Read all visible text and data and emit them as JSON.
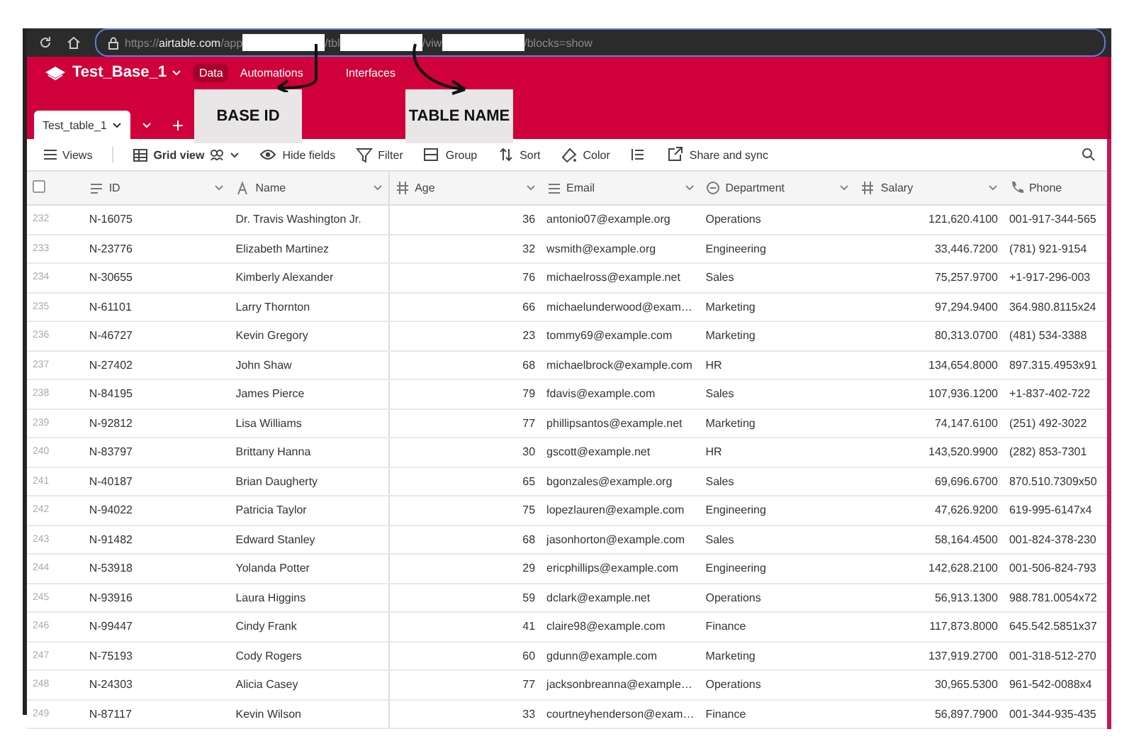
{
  "browser": {
    "url_segments": [
      {
        "text": "https://",
        "kind": "dim"
      },
      {
        "text": "airtable.com",
        "kind": "host"
      },
      {
        "text": "/app",
        "kind": "dim"
      },
      {
        "text": "/tbl",
        "kind": "dim"
      },
      {
        "text": "/viw",
        "kind": "dim"
      },
      {
        "text": "/blocks=show",
        "kind": "dim"
      }
    ]
  },
  "app": {
    "base_name": "Test_Base_1",
    "nav": [
      {
        "label": "Data",
        "selected": true
      },
      {
        "label": "Automations",
        "selected": false
      },
      {
        "label": "Interfaces",
        "selected": false
      }
    ]
  },
  "table_tabs": [
    {
      "label": "Test_table_1",
      "selected": true
    }
  ],
  "annotations": [
    {
      "label": "BASE ID"
    },
    {
      "label": "TABLE NAME"
    }
  ],
  "toolbar": {
    "views": "Views",
    "view_name": "Grid view",
    "items": [
      {
        "label": "Hide fields",
        "kind": "eye"
      },
      {
        "label": "Filter",
        "kind": "filter"
      },
      {
        "label": "Group",
        "kind": "group"
      },
      {
        "label": "Sort",
        "kind": "sort"
      },
      {
        "label": "Color",
        "kind": "color"
      },
      {
        "kind": "height"
      },
      {
        "label": "Share and sync",
        "kind": "share"
      }
    ]
  },
  "table": {
    "columns": [
      {
        "kind": "checkbox",
        "checked": false
      },
      {
        "label": "ID",
        "kind": "text"
      },
      {
        "label": "Name",
        "kind": "user"
      },
      {
        "label": "Age",
        "kind": "number"
      },
      {
        "label": "Email",
        "kind": "email"
      },
      {
        "label": "Department",
        "kind": "select"
      },
      {
        "label": "Salary",
        "kind": "number"
      },
      {
        "label": "Phone",
        "kind": "phone"
      }
    ],
    "rows": [
      [
        "232",
        "N-16075",
        "Dr. Travis Washington Jr.",
        "36",
        "antonio07@example.org",
        "Operations",
        "121,620.4100",
        "001-917-344-565"
      ],
      [
        "233",
        "N-23776",
        "Elizabeth Martinez",
        "32",
        "wsmith@example.org",
        "Engineering",
        "33,446.7200",
        "(781) 921-9154"
      ],
      [
        "234",
        "N-30655",
        "Kimberly Alexander",
        "76",
        "michaelross@example.net",
        "Sales",
        "75,257.9700",
        "+1-917-296-003"
      ],
      [
        "235",
        "N-61101",
        "Larry Thornton",
        "66",
        "michaelunderwood@exam…",
        "Marketing",
        "97,294.9400",
        "364.980.8115x24"
      ],
      [
        "236",
        "N-46727",
        "Kevin Gregory",
        "23",
        "tommy69@example.com",
        "Marketing",
        "80,313.0700",
        "(481) 534-3388"
      ],
      [
        "237",
        "N-27402",
        "John Shaw",
        "68",
        "michaelbrock@example.com",
        "HR",
        "134,654.8000",
        "897.315.4953x91"
      ],
      [
        "238",
        "N-84195",
        "James Pierce",
        "79",
        "fdavis@example.com",
        "Sales",
        "107,936.1200",
        "+1-837-402-722"
      ],
      [
        "239",
        "N-92812",
        "Lisa Williams",
        "77",
        "phillipsantos@example.net",
        "Marketing",
        "74,147.6100",
        "(251) 492-3022"
      ],
      [
        "240",
        "N-83797",
        "Brittany Hanna",
        "30",
        "gscott@example.net",
        "HR",
        "143,520.9900",
        "(282) 853-7301"
      ],
      [
        "241",
        "N-40187",
        "Brian Daugherty",
        "65",
        "bgonzales@example.org",
        "Sales",
        "69,696.6700",
        "870.510.7309x50"
      ],
      [
        "242",
        "N-94022",
        "Patricia Taylor",
        "75",
        "lopezlauren@example.com",
        "Engineering",
        "47,626.9200",
        "619-995-6147x4"
      ],
      [
        "243",
        "N-91482",
        "Edward Stanley",
        "68",
        "jasonhorton@example.com",
        "Sales",
        "58,164.4500",
        "001-824-378-230"
      ],
      [
        "244",
        "N-53918",
        "Yolanda Potter",
        "29",
        "ericphillips@example.com",
        "Engineering",
        "142,628.2100",
        "001-506-824-793"
      ],
      [
        "245",
        "N-93916",
        "Laura Higgins",
        "59",
        "dclark@example.net",
        "Operations",
        "56,913.1300",
        "988.781.0054x72"
      ],
      [
        "246",
        "N-99447",
        "Cindy Frank",
        "41",
        "claire98@example.com",
        "Finance",
        "117,873.8000",
        "645.542.5851x37"
      ],
      [
        "247",
        "N-75193",
        "Cody Rogers",
        "60",
        "gdunn@example.com",
        "Marketing",
        "137,919.2700",
        "001-318-512-270"
      ],
      [
        "248",
        "N-24303",
        "Alicia Casey",
        "77",
        "jacksonbreanna@example…",
        "Operations",
        "30,965.5300",
        "961-542-0088x4"
      ],
      [
        "249",
        "N-87117",
        "Kevin Wilson",
        "33",
        "courtneyhenderson@exam…",
        "Finance",
        "56,897.7900",
        "001-344-935-435"
      ]
    ]
  }
}
